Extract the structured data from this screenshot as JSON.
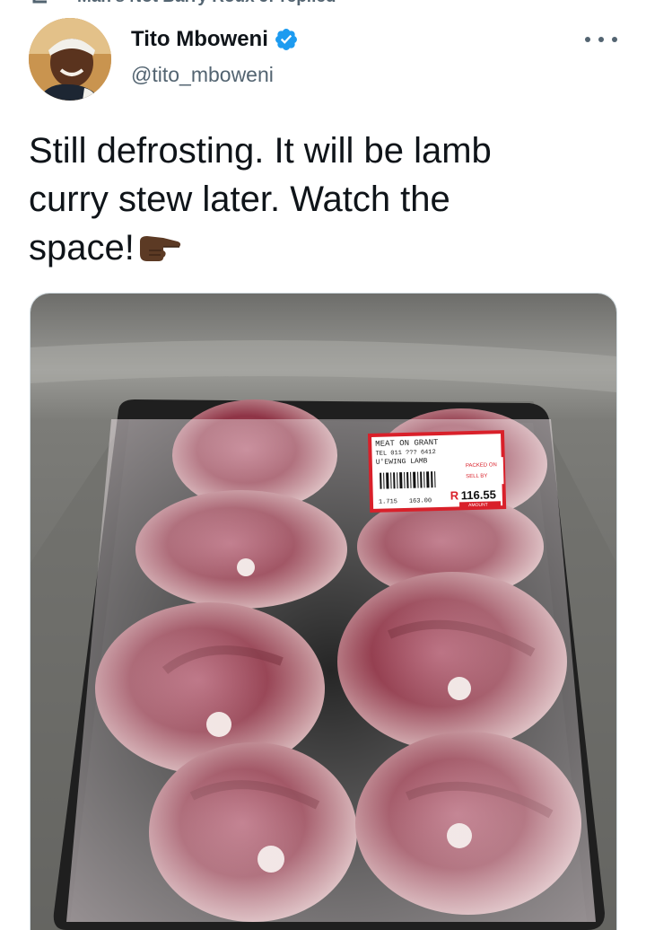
{
  "context": {
    "replied_text": "Man's Not Barry Roux Jr replied"
  },
  "tweet": {
    "author": {
      "display_name": "Tito Mboweni",
      "handle": "@tito_mboweni",
      "verified": true,
      "avatar_icon": "avatar-photo"
    },
    "text_parts": [
      "Still defrosting. It will be lamb",
      "curry stew later. Watch the",
      "space!"
    ],
    "emoji": "backhand-index-pointing-right-dark-skin",
    "more_icon": "more-options-icon",
    "media": {
      "label": {
        "title": "MEAT ON GRANT",
        "tel": "TEL 011 ??? 6412",
        "product": "U'EWING LAMB",
        "packed_on": "PACKED ON",
        "sell_by": "SELL BY",
        "mass": "1.715",
        "price_per_kg": "163.00",
        "currency": "R",
        "amount": "116.55",
        "amount_label": "AMOUNT"
      }
    }
  },
  "colors": {
    "text": "#0f1419",
    "secondary": "#536471",
    "verified_blue": "#1d9bf0",
    "border": "#cfd9de",
    "label_red": "#d9202a"
  }
}
